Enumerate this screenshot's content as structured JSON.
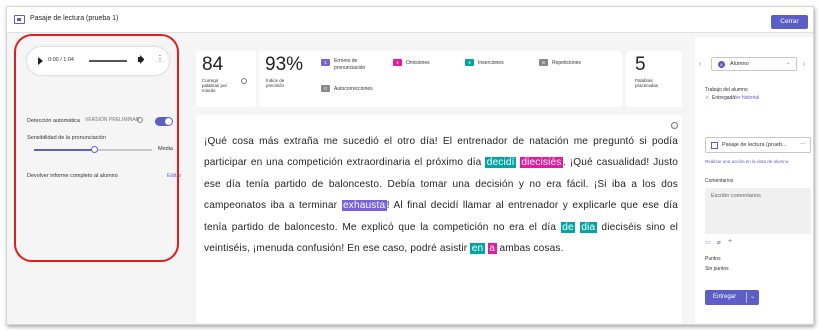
{
  "window": {
    "title": "Pasaje de lectura (prueba 1)",
    "close_label": "Cerrar"
  },
  "audio": {
    "time": "0:00 / 1:04",
    "more": "⋮"
  },
  "settings": {
    "auto_detect_label": "Detección automática",
    "auto_detect_badge": "VERSIÓN PRELIMINAR",
    "auto_detect_on": true,
    "sensitivity_label": "Sensibilidad de la pronunciación",
    "sensitivity_value": "Media",
    "sensitivity_level": 0.52,
    "report_label": "Devolver informe completo al alumno",
    "report_edit": "Editar"
  },
  "stats": {
    "correct_wpm": "84",
    "correct_wpm_label": "Corregir palabras por minuto",
    "accuracy": "93%",
    "accuracy_label": "Índice de precisión",
    "practiced": "5",
    "practiced_label": "Palabras practicadas",
    "error_types": [
      {
        "count": "1",
        "label": "Errores de pronunciación",
        "color": "#7a61d9"
      },
      {
        "count": "2",
        "label": "Omisiones",
        "color": "#e61a9e"
      },
      {
        "count": "4",
        "label": "Inserciones",
        "color": "#00a6a6"
      },
      {
        "count": "8",
        "label": "Repeticiones",
        "color": "#8a8886"
      },
      {
        "count": "0",
        "label": "Autocorrecciones",
        "color": "#8a8886"
      }
    ]
  },
  "passage": {
    "s1": "¡Qué cosa más extraña me sucedió el otro día! El entrenador de natación me preguntó si podía participar en una competición extraordinaria el próximo día ",
    "w1": "decidí",
    "w2": "diecisiés",
    "s2": ". ¡Qué casualidad! Justo ese día tenía partido de baloncesto. Debía tomar una decisión y no era fácil. ¡Si iba a los dos campeonatos iba a terminar ",
    "w3": "exhausta",
    "s3": "! Al final decidí llamar al entrenador y explicarle que ese día tenía partido de baloncesto. Me explicó que la competición no era el día ",
    "w4": "de",
    "w5": "dia",
    "s4": " dieciséis sino el veintiséis, ¡menuda confusión! En ese caso, podré asistir ",
    "w6": "en",
    "w7": "a",
    "s5": " ambas cosas."
  },
  "right": {
    "student_label": "Alumno",
    "student_initial": "A",
    "work_label": "Trabajo del alumno",
    "submitted_label": "Entregado",
    "history_link": "Ver historial",
    "file_name": "Pasaje de lectura (prueb...",
    "file_more": "···",
    "action_link": "Realizar una acción en la vista de alumno",
    "comments_label": "Comentarios",
    "comments_placeholder": "Escribir comentarios",
    "points_label": "Puntos",
    "points_value": "Sin puntos",
    "submit_label": "Entregar"
  },
  "colors": {
    "accent": "#5b5fc7",
    "annotation_border": "#e21d1d"
  }
}
